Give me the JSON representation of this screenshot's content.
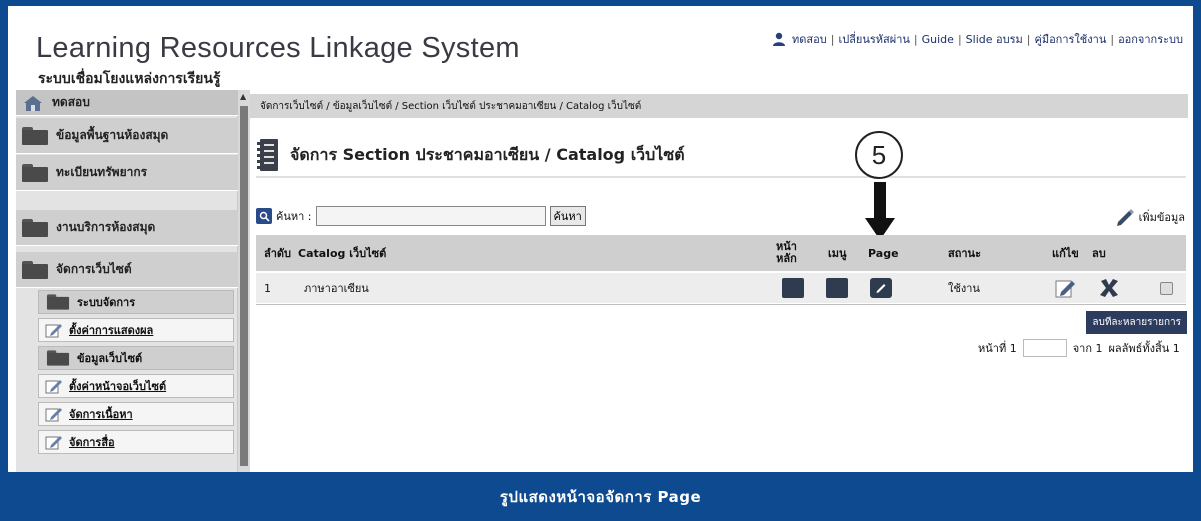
{
  "header": {
    "title": "Learning Resources Linkage System",
    "subtitle": "ระบบเชื่อมโยงแหล่งการเรียนรู้",
    "user_label": "ทดสอบ",
    "links": [
      "เปลี่ยนรหัสผ่าน",
      "Guide",
      "Slide อบรม",
      "คู่มือการใช้งาน",
      "ออกจากระบบ"
    ]
  },
  "sidebar": {
    "home_label": "ทดสอบ",
    "items": [
      {
        "label": "ข้อมูลพื้นฐานห้องสมุด"
      },
      {
        "label": "ทะเบียนทรัพยากร"
      },
      {
        "label": "งานบริการห้องสมุด"
      },
      {
        "label": "จัดการเว็บไซต์"
      }
    ],
    "subitems": [
      {
        "label": "ระบบจัดการ",
        "kind": "folder"
      },
      {
        "label": "ตั้งค่าการแสดงผล",
        "kind": "link"
      },
      {
        "label": "ข้อมูลเว็บไซต์",
        "kind": "folder"
      },
      {
        "label": "ตั้งค่าหน้าจอเว็บไซต์",
        "kind": "link"
      },
      {
        "label": "จัดการเนื้อหา",
        "kind": "link"
      },
      {
        "label": "จัดการสื่อ",
        "kind": "link"
      }
    ]
  },
  "main": {
    "breadcrumb": "จัดการเว็บไซต์ / ข้อมูลเว็บไซต์ / Section เว็บไซต์ ประชาคมอาเซียน / Catalog เว็บไซต์",
    "page_title": "จัดการ Section ประชาคมอาเซียน / Catalog เว็บไซต์",
    "callout_number": "5",
    "search": {
      "label": "ค้นหา :",
      "value": "",
      "button": "ค้นหา"
    },
    "add_label": "เพิ่มข้อมูล",
    "table": {
      "columns": {
        "order": "ลำดับ",
        "catalog": "Catalog เว็บไซต์",
        "home_line1": "หน้า",
        "home_line2": "หลัก",
        "menu": "เมนู",
        "page": "Page",
        "status": "สถานะ",
        "edit": "แก้ไข",
        "delete": "ลบ"
      },
      "rows": [
        {
          "order": "1",
          "catalog": "ภาษาอาเซียน",
          "status": "ใช้งาน"
        }
      ]
    },
    "multi_delete": "ลบทีละหลายรายการ",
    "pager": {
      "page_label": "หน้าที่ 1",
      "page_value": "",
      "of_label": "จาก 1",
      "total_label": "ผลลัพธ์ทั้งสิ้น 1"
    }
  },
  "caption": "รูปแสดงหน้าจอจัดการ Page",
  "colors": {
    "caption_bg": "#0d4a8f",
    "accent_dark": "#2f3b4f"
  }
}
